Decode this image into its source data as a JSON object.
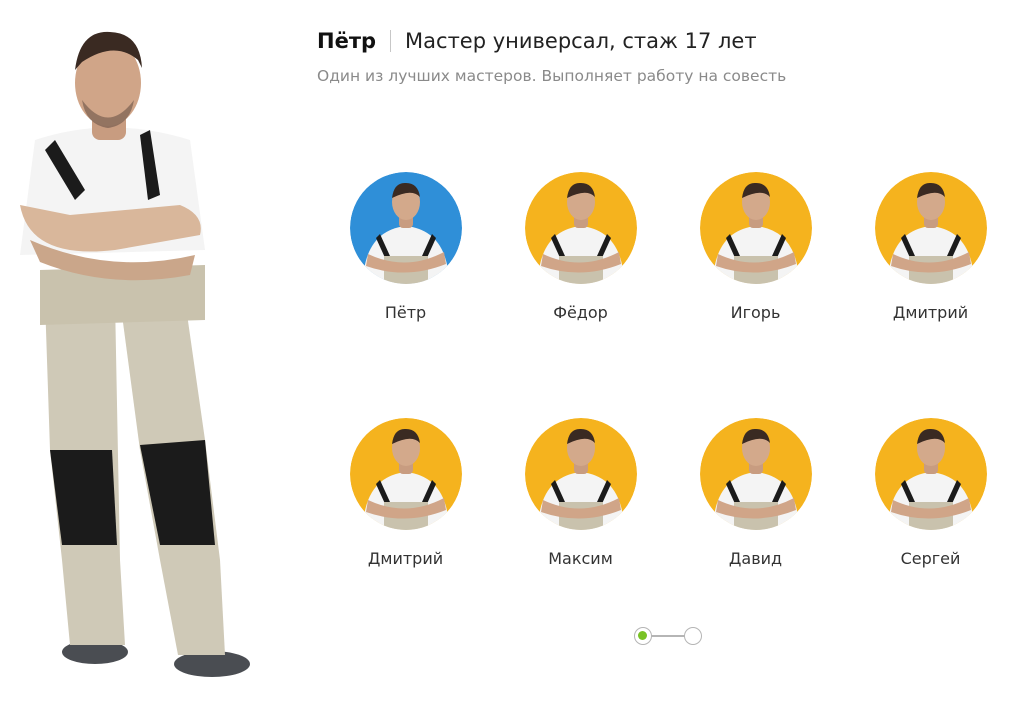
{
  "featured": {
    "name": "Пётр",
    "role": "Мастер универсал, стаж 17 лет",
    "description": "Один из лучших мастеров. Выполняет работу на совесть"
  },
  "colors": {
    "active_ring": "#2f8fd8",
    "inactive_ring": "#f5b31e",
    "pager_active": "#79c225"
  },
  "masters": [
    {
      "name": "Пётр",
      "active": true
    },
    {
      "name": "Фёдор",
      "active": false
    },
    {
      "name": "Игорь",
      "active": false
    },
    {
      "name": "Дмитрий",
      "active": false
    },
    {
      "name": "Дмитрий",
      "active": false
    },
    {
      "name": "Максим",
      "active": false
    },
    {
      "name": "Давид",
      "active": false
    },
    {
      "name": "Сергей",
      "active": false
    }
  ],
  "pager": {
    "pages": 2,
    "current": 1
  }
}
